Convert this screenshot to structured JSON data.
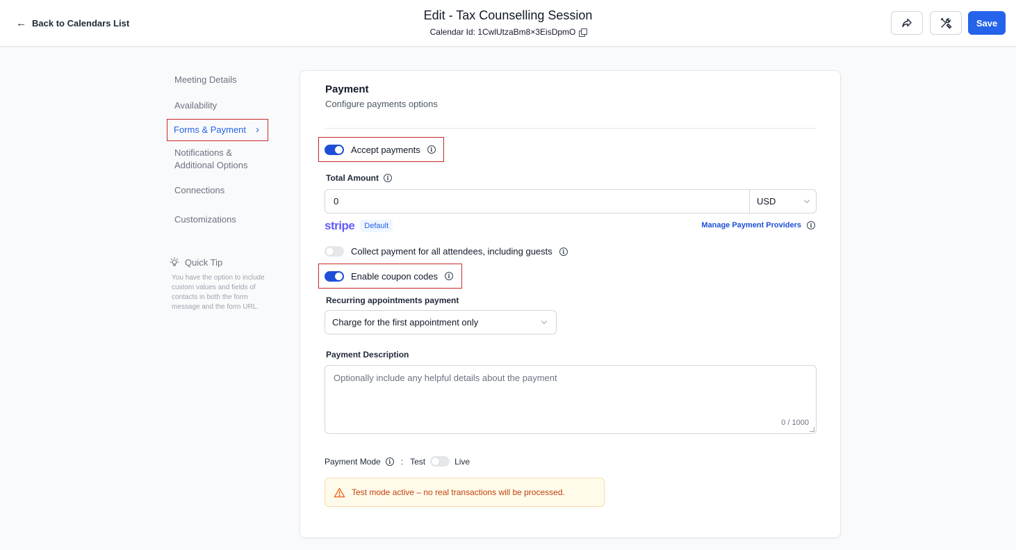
{
  "header": {
    "back_label": "Back to Calendars List",
    "title": "Edit - Tax Counselling Session",
    "calendar_id": "Calendar Id: 1CwlUtzaBm8×3EisDpmO",
    "save_label": "Save"
  },
  "sidebar": {
    "items": [
      {
        "label": "Meeting Details"
      },
      {
        "label": "Availability"
      },
      {
        "label": "Forms & Payment"
      },
      {
        "label": "Notifications & Additional Options"
      },
      {
        "label": "Connections"
      },
      {
        "label": "Customizations"
      }
    ],
    "active_chevron": "›",
    "tip_title": "Quick Tip",
    "tip_text": "You have the option to include custom values and fields of contacts in both the form message and the form URL."
  },
  "payment": {
    "title": "Payment",
    "subtitle": "Configure payments options",
    "accept_payments": {
      "label": "Accept payments",
      "enabled": true
    },
    "total_amount": {
      "label": "Total Amount",
      "value": "0",
      "currency": "USD"
    },
    "provider": {
      "logo": "stripe",
      "badge": "Default",
      "manage_label": "Manage Payment Providers"
    },
    "collect_all": {
      "label": "Collect payment for all attendees, including guests",
      "enabled": false
    },
    "coupon_codes": {
      "label": "Enable coupon codes",
      "enabled": true
    },
    "recurring": {
      "label": "Recurring appointments payment",
      "value": "Charge for the first appointment only"
    },
    "description": {
      "label": "Payment Description",
      "placeholder": "Optionally include any helpful details about the payment",
      "counter": "0 / 1000"
    },
    "mode": {
      "label": "Payment Mode",
      "separator": ":",
      "test_label": "Test",
      "live_label": "Live",
      "live_enabled": false
    },
    "alert": "Test mode active – no real transactions will be processed."
  },
  "colors": {
    "primary": "#2563eb",
    "highlight_border": "#c62828",
    "warning_text": "#c2410c",
    "stripe": "#635bff"
  }
}
